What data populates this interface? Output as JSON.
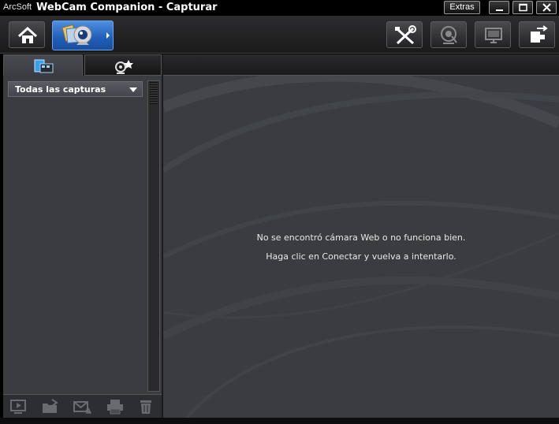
{
  "titlebar": {
    "brand": "ArcSoft",
    "app_title": "WebCam Companion - Capturar",
    "extras_label": "Extras",
    "buttons": [
      "minimize-icon",
      "maximize-icon",
      "close-icon"
    ]
  },
  "toolbar": {
    "left": [
      "home-icon",
      "webcam-capture-icon"
    ],
    "right": [
      "tools-icon",
      "webcam-icon",
      "monitor-icon",
      "connect-icon"
    ]
  },
  "left_panel": {
    "tabs": [
      "captures-tab-icon",
      "effects-tab-icon"
    ],
    "filter": {
      "selected": "Todas las capturas"
    },
    "bottom_actions": [
      "play-icon",
      "open-folder-icon",
      "email-icon",
      "print-icon",
      "trash-icon"
    ]
  },
  "main": {
    "message_line1": "No se encontró cámara Web o no funciona bien.",
    "message_line2": "Haga clic en Conectar y vuelva a intentarlo."
  },
  "colors": {
    "accent": "#2f72d0",
    "panel_bg": "#3b3c42",
    "toolbar_bg": "#222224"
  }
}
